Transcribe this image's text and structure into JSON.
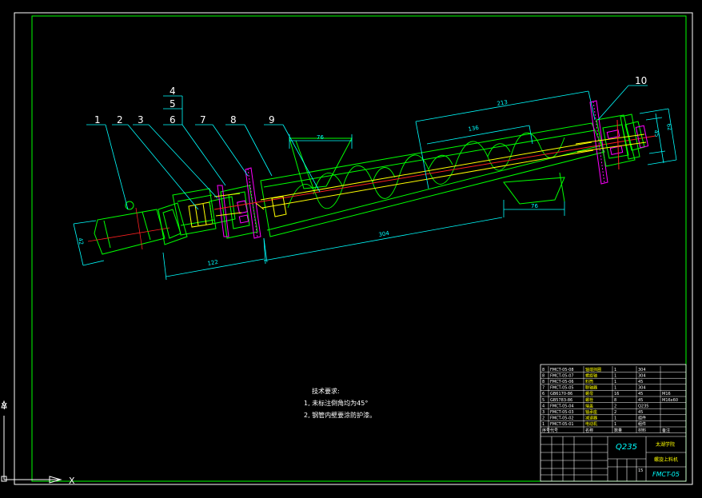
{
  "colors": {
    "background": "#000000",
    "frame": "#ffffff",
    "outline": "#00ff00",
    "dimension": "#00ffff",
    "centerline": "#ff2020",
    "hidden": "#ffff00",
    "flange": "#ff00ff"
  },
  "balloons": [
    "1",
    "2",
    "3",
    "4",
    "5",
    "6",
    "7",
    "8",
    "9",
    "10"
  ],
  "dimensions": {
    "d_76_top": "76",
    "d_213": "213",
    "d_136": "136",
    "d_76_bottom": "76",
    "d_304": "304",
    "d_122": "122",
    "d_42_left": "42",
    "d_45_right": "45",
    "d_62_right": "62"
  },
  "notes": {
    "title": "技术要求:",
    "line1": "1, 未标注倒角均为45°",
    "line2": "2, 钢管内壁要涂防护漆。"
  },
  "title_block": {
    "material": "Q235",
    "unit_name": "太湖学院",
    "drawing_name": "螺旋上料机",
    "drawing_number": "FMCT-05",
    "scale": "15"
  },
  "bom": [
    {
      "no": "8",
      "code": "FMCT-05-08",
      "name": "轴端挡圈",
      "qty": "1",
      "mat": "304",
      "note": ""
    },
    {
      "no": "8",
      "code": "FMCT-05-07",
      "name": "螺旋轴",
      "qty": "1",
      "mat": "304",
      "note": ""
    },
    {
      "no": "8",
      "code": "FMCT-05-06",
      "name": "料筒",
      "qty": "1",
      "mat": "45",
      "note": ""
    },
    {
      "no": "7",
      "code": "FMCT-05-05",
      "name": "联轴器",
      "qty": "1",
      "mat": "304",
      "note": ""
    },
    {
      "no": "6",
      "code": "GB6170-86",
      "name": "螺母",
      "qty": "16",
      "mat": "45",
      "note": "M16"
    },
    {
      "no": "5",
      "code": "GB5783-86",
      "name": "螺栓",
      "qty": "8",
      "mat": "45",
      "note": "M16x60"
    },
    {
      "no": "4",
      "code": "FMCT-05-04",
      "name": "端盖",
      "qty": "2",
      "mat": "Q235",
      "note": ""
    },
    {
      "no": "3",
      "code": "FMCT-05-03",
      "name": "轴承座",
      "qty": "2",
      "mat": "45",
      "note": ""
    },
    {
      "no": "2",
      "code": "FMCT-05-02",
      "name": "减速器",
      "qty": "1",
      "mat": "组件",
      "note": ""
    },
    {
      "no": "1",
      "code": "FMCT-05-01",
      "name": "电动机",
      "qty": "1",
      "mat": "组件",
      "note": ""
    }
  ],
  "bom_header": [
    "序号",
    "代号",
    "名称",
    "数量",
    "材料",
    "备注"
  ],
  "ucs": {
    "x_label": "X",
    "y_label": "Y"
  }
}
